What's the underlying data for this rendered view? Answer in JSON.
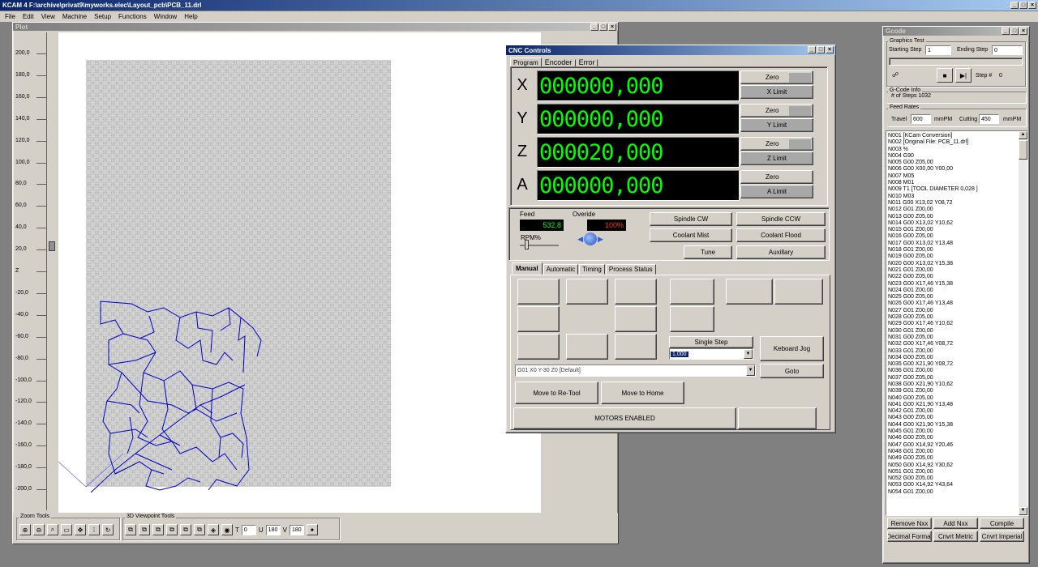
{
  "app": {
    "title": "KCAM 4  F:\\archive\\privat9\\myworks.elec\\Layout_pcb\\PCB_11.drl",
    "menu": [
      "File",
      "Edit",
      "View",
      "Machine",
      "Setup",
      "Functions",
      "Window",
      "Help"
    ]
  },
  "plot": {
    "title": "Plot",
    "ruler": [
      "200,0",
      "180,0",
      "160,0",
      "140,0",
      "120,0",
      "100,0",
      "80,0",
      "60,0",
      "40,0",
      "20,0",
      "Z",
      "-20,0",
      "-40,0",
      "-60,0",
      "-80,0",
      "-100,0",
      "-120,0",
      "-140,0",
      "-160,0",
      "-180,0",
      "-200,0"
    ],
    "zoom_tools_label": "Zoom Tools",
    "viewpoint_label": "3D Viewpoint Tools",
    "t_label": "T",
    "t_value": "0",
    "u_label": "U",
    "u_value": "180",
    "v_label": "V",
    "v_value": "180"
  },
  "cnc": {
    "title": "CNC Controls",
    "top_tabs": [
      "Program",
      "Encoder",
      "Error"
    ],
    "axes": [
      {
        "name": "X",
        "value": "000000,000",
        "zero": "Zero",
        "limit": "X Limit"
      },
      {
        "name": "Y",
        "value": "000000,000",
        "zero": "Zero",
        "limit": "Y Limit"
      },
      {
        "name": "Z",
        "value": "000020,000",
        "zero": "Zero",
        "limit": "Z Limit"
      },
      {
        "name": "A",
        "value": "000000,000",
        "zero": "Zero",
        "limit": "A Limit"
      }
    ],
    "feed_label": "Feed",
    "feed_value": "532,8",
    "override_label": "Overide",
    "override_value": "100%",
    "rpm_label": "RPM%",
    "spindle_cw": "Spindle CW",
    "spindle_ccw": "Spindle CCW",
    "coolant_mist": "Coolant Mist",
    "coolant_flood": "Coolant Flood",
    "tune": "Tune",
    "auxiliary": "Auxillary",
    "mode_tabs": [
      "Manual",
      "Automatic",
      "Timing",
      "Process Status"
    ],
    "single_step": "Single Step",
    "step_value": "1,000",
    "keyboard_jog": "Keboard Jog",
    "command": "G01 X0 Y-30 Z0 [Default]",
    "goto": "Goto",
    "move_retool": "Move to Re-Tool",
    "move_home": "Move to Home",
    "motors": "MOTORS ENABLED"
  },
  "gcode": {
    "title": "Gcode",
    "graphics_test": "Graphics Test",
    "starting_step_label": "Starting Step",
    "starting_step": "1",
    "ending_step_label": "Ending Step",
    "ending_step": "0",
    "step_label": "Step #",
    "step_value": "0",
    "info_label": "G-Code Info",
    "num_steps": "# of Steps   1032",
    "feed_rates_label": "Feed Rates",
    "travel_label": "Travel",
    "travel_value": "600",
    "travel_unit": "mmPM",
    "cutting_label": "Cutting",
    "cutting_value": "450",
    "cutting_unit": "mmPM",
    "lines": [
      "N001 [KCam Conversion]",
      "N002 [Original File: PCB_11.drl]",
      "N003 %",
      "N004 G90",
      "N005 G00 Z05,00",
      "N006 G00 X00,00 Y00,00",
      "N007 M05",
      "N008 M01",
      "N009 T1 [TOOL DIAMETER 0,028 ]",
      "N010 M03",
      "N011 G00 X13,02 Y08,72",
      "N012 G01 Z00,00",
      "N013 G00 Z05,00",
      "N014 G00 X13,02 Y10,62",
      "N015 G01 Z00,00",
      "N016 G00 Z05,00",
      "N017 G00 X13,02 Y13,48",
      "N018 G01 Z00,00",
      "N019 G00 Z05,00",
      "N020 G00 X13,02 Y15,38",
      "N021 G01 Z00,00",
      "N022 G00 Z05,00",
      "N023 G00 X17,46 Y15,38",
      "N024 G01 Z00,00",
      "N025 G00 Z05,00",
      "N026 G00 X17,46 Y13,48",
      "N027 G01 Z00,00",
      "N028 G00 Z05,00",
      "N029 G00 X17,46 Y10,62",
      "N030 G01 Z00,00",
      "N031 G00 Z05,00",
      "N032 G00 X17,46 Y08,72",
      "N033 G01 Z00,00",
      "N034 G00 Z05,00",
      "N035 G00 X21,90 Y08,72",
      "N036 G01 Z00,00",
      "N037 G00 Z05,00",
      "N038 G00 X21,90 Y10,62",
      "N039 G01 Z00,00",
      "N040 G00 Z05,00",
      "N041 G00 X21,90 Y13,48",
      "N042 G01 Z00,00",
      "N043 G00 Z05,00",
      "N044 G00 X21,90 Y15,38",
      "N045 G01 Z00,00",
      "N046 G00 Z05,00",
      "N047 G00 X14,92 Y20,46",
      "N048 G01 Z00,00",
      "N049 G00 Z05,00",
      "N050 G00 X14,92 Y30,62",
      "N051 G01 Z00,00",
      "N052 G00 Z05,00",
      "N053 G00 X14,92 Y43,64",
      "N054 G01 Z00,00"
    ],
    "remove_nxx": "Remove  Nxx",
    "add_nxx": "Add Nxx",
    "compile": "Compile",
    "decimal_format": "Decimal Format",
    "cnvt_metric": "Cnvrt Metric",
    "cnvt_imperial": "Cnvrt Imperial"
  }
}
